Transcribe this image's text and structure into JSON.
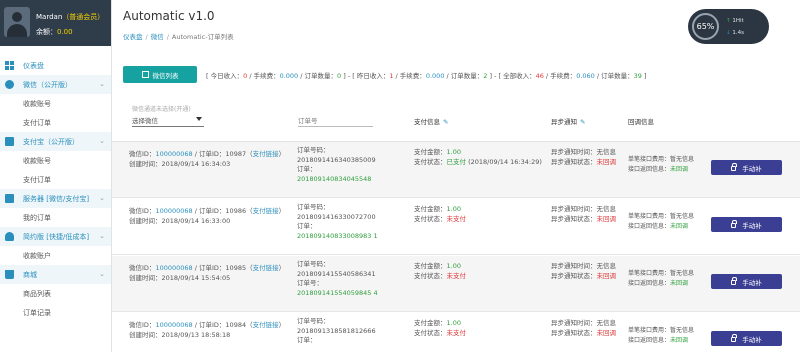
{
  "user": {
    "name": "Mardan",
    "level_badge": "（普通会员）",
    "balance_label": "余额：",
    "balance_value": "0.00"
  },
  "sidebar": {
    "dashboard": "仪表盘",
    "sections": [
      {
        "label": "微信（公开版）",
        "items": [
          "收款账号",
          "支付订单"
        ]
      },
      {
        "label": "支付宝（公开版）",
        "items": [
          "收款账号",
          "支付订单"
        ]
      },
      {
        "label": "服务器 [微信/支付宝]",
        "items": [
          "我的订单"
        ]
      },
      {
        "label": "简约版 [快捷/低成本]",
        "items": [
          "收款账户"
        ]
      },
      {
        "label": "商城",
        "items": [
          "商品列表",
          "订单记录"
        ]
      }
    ]
  },
  "header": {
    "title": "Automatic v1.0",
    "breadcrumb": [
      "仪表盘",
      "微信",
      "Automatic-订单列表"
    ],
    "gauge": {
      "percent": "65%",
      "up": "1Hit",
      "down": "1.4s"
    }
  },
  "toolbar": {
    "list_button": "微信列表",
    "summary": {
      "today_income_label": "[ 今日收入：",
      "today_income": "0",
      "today_fee_label": " / 手续费：",
      "today_fee": "0.000",
      "today_count_label": " / 订单数量：",
      "today_count": "0",
      "yesterday_income_label": " ] - [ 昨日收入：",
      "yesterday_income": "1",
      "yesterday_fee_label": " / 手续费：",
      "yesterday_fee": "0.000",
      "yesterday_count_label": " / 订单数量：",
      "yesterday_count": "2",
      "all_income_label": " ] - [ 全部收入：",
      "all_income": "46",
      "all_fee_label": " / 手续费：",
      "all_fee": "0.060",
      "all_count_label": " / 订单数量：",
      "all_count": "39",
      "end": " ]"
    }
  },
  "filters": {
    "rule_note": "微信通道未选择(开通)",
    "select_value": "选择微信",
    "order_no_placeholder": "订单号"
  },
  "columns": {
    "pay_info": "支付信息",
    "async_notify": "异步通知",
    "callback_info": "回调信息"
  },
  "orders": [
    {
      "wx_label": "微信ID：",
      "wx_id": "100000068",
      "order_id_label": " / 订单ID：",
      "order_id": "10987",
      "link_open": "（",
      "pay_link": "支付链接",
      "link_close": "）",
      "created_label": "创建时间：",
      "created": "2018/09/14 16:34:03",
      "order_no_label": "订单号码：",
      "order_no": "2018091416340385009",
      "sys_label": "订单：",
      "sys_no": "201809140834045548",
      "amount_label": "支付金额：",
      "amount": "1.00",
      "status_label": "支付状态：",
      "status": "已支付",
      "status_paid": true,
      "paid_time": "(2018/09/14 16:34:29)",
      "notify_time_label": "异步通知时间：",
      "notify_time": "无信息",
      "notify_status_label": "异步通知状态：",
      "notify_status": "未回调",
      "cb_label_1": "单笔接口费用：",
      "cb_val_1": "暂无信息",
      "cb_label_2": "接口返回信息：",
      "cb_val_2": "未回调",
      "button": "手动补"
    },
    {
      "wx_label": "微信ID：",
      "wx_id": "100000068",
      "order_id_label": " / 订单ID：",
      "order_id": "10986",
      "link_open": "（",
      "pay_link": "支付链接",
      "link_close": "）",
      "created_label": "创建时间：",
      "created": "2018/09/14 16:33:00",
      "order_no_label": "订单号码：",
      "order_no": "2018091416330072700",
      "sys_label": "订单：",
      "sys_no": "201809140833008983 1",
      "amount_label": "支付金额：",
      "amount": "1.00",
      "status_label": "支付状态：",
      "status": "未支付",
      "status_paid": false,
      "paid_time": "",
      "notify_time_label": "异步通知时间：",
      "notify_time": "无信息",
      "notify_status_label": "异步通知状态：",
      "notify_status": "未回调",
      "cb_label_1": "单笔接口费用：",
      "cb_val_1": "暂无信息",
      "cb_label_2": "接口返回信息：",
      "cb_val_2": "未回调",
      "button": "手动补"
    },
    {
      "wx_label": "微信ID：",
      "wx_id": "100000068",
      "order_id_label": " / 订单ID：",
      "order_id": "10985",
      "link_open": "（",
      "pay_link": "支付链接",
      "link_close": "）",
      "created_label": "创建时间：",
      "created": "2018/09/14 15:54:05",
      "order_no_label": "订单号码：",
      "order_no": "2018091415540586341",
      "sys_label": "订单号：",
      "sys_no": "201809141554059845 4",
      "amount_label": "支付金额：",
      "amount": "1.00",
      "status_label": "支付状态：",
      "status": "未支付",
      "status_paid": false,
      "paid_time": "",
      "notify_time_label": "异步通知时间：",
      "notify_time": "无信息",
      "notify_status_label": "异步通知状态：",
      "notify_status": "未回调",
      "cb_label_1": "单笔接口费用：",
      "cb_val_1": "暂无信息",
      "cb_label_2": "接口返回信息：",
      "cb_val_2": "未回调",
      "button": "手动补"
    },
    {
      "wx_label": "微信ID：",
      "wx_id": "100000068",
      "order_id_label": " / 订单ID：",
      "order_id": "10984",
      "link_open": "（",
      "pay_link": "支付链接",
      "link_close": "）",
      "created_label": "创建时间：",
      "created": "2018/09/13 18:58:18",
      "order_no_label": "订单号码：",
      "order_no": "2018091318581812666",
      "sys_label": "订单：",
      "sys_no": "",
      "amount_label": "支付金额：",
      "amount": "1.00",
      "status_label": "支付状态：",
      "status": "未支付",
      "status_paid": false,
      "paid_time": "",
      "notify_time_label": "异步通知时间：",
      "notify_time": "无信息",
      "notify_status_label": "异步通知状态：",
      "notify_status": "未回调",
      "cb_label_1": "单笔接口费用：",
      "cb_val_1": "暂无信息",
      "cb_label_2": "接口返回信息：",
      "cb_val_2": "未回调",
      "button": "手动补"
    }
  ]
}
